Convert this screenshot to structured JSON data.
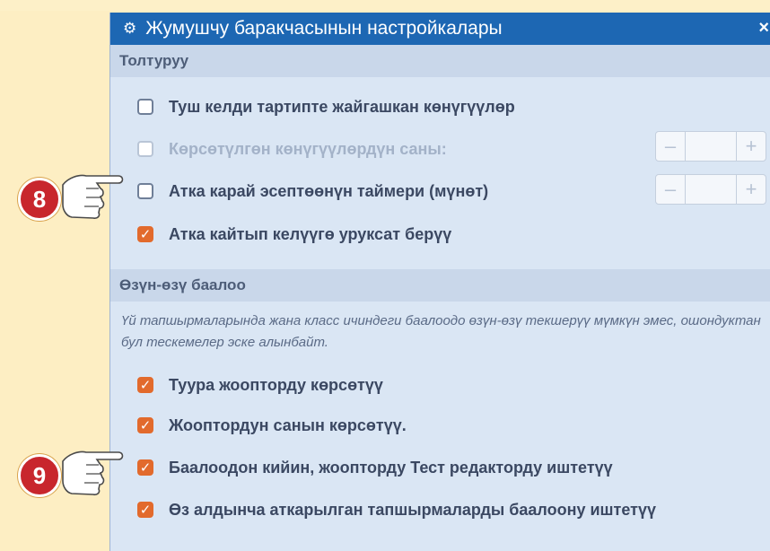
{
  "dialog": {
    "title": "Жумушчу баракчасынын настройкалары",
    "close_symbol": "×",
    "icon": "gear-icon"
  },
  "sections": {
    "filling": {
      "header": "Толтуруу",
      "options": {
        "random_order": {
          "label": "Туш келди тартипте жайгашкан көнүгүүлөр",
          "checked": false,
          "enabled": true
        },
        "shown_count": {
          "label": "Көрсөтүлгөн көнүгүүлөрдүн саны:",
          "checked": false,
          "enabled": false,
          "stepper": {
            "minus": "–",
            "plus": "+",
            "value": ""
          }
        },
        "timer": {
          "label": "Атка карай эсептөөнүн таймери (мүнөт)",
          "checked": false,
          "enabled": true,
          "stepper": {
            "minus": "–",
            "plus": "+",
            "value": ""
          }
        },
        "allow_return": {
          "label": "Атка кайтып келүүгө уруксат берүү",
          "checked": true,
          "enabled": true
        }
      }
    },
    "self_assessment": {
      "header": "Өзүн-өзү баалоо",
      "note": "Үй тапшырмаларында жана класс ичиндеги баалоодо өзүн-өзү текшерүү мүмкүн эмес, ошондуктан бул тескемелер эске алынбайт.",
      "options": {
        "show_correct": {
          "label": "Туура жоопторду көрсөтүү",
          "checked": true
        },
        "show_count": {
          "label": "Жооптордун санын көрсөтүү.",
          "checked": true
        },
        "send_to_editor": {
          "label": "Баалоодон кийин, жоопторду Тест редакторду иштетүү",
          "checked": true
        },
        "pre_grade": {
          "label": "Өз алдынча аткарылган тапшырмаларды баалоону иштетүү",
          "checked": true
        }
      }
    }
  },
  "markers": {
    "m8": "8",
    "m9": "9"
  },
  "colors": {
    "titlebar": "#1d67b3",
    "checkbox_checked": "#e26a2c",
    "marker": "#c8262d"
  }
}
